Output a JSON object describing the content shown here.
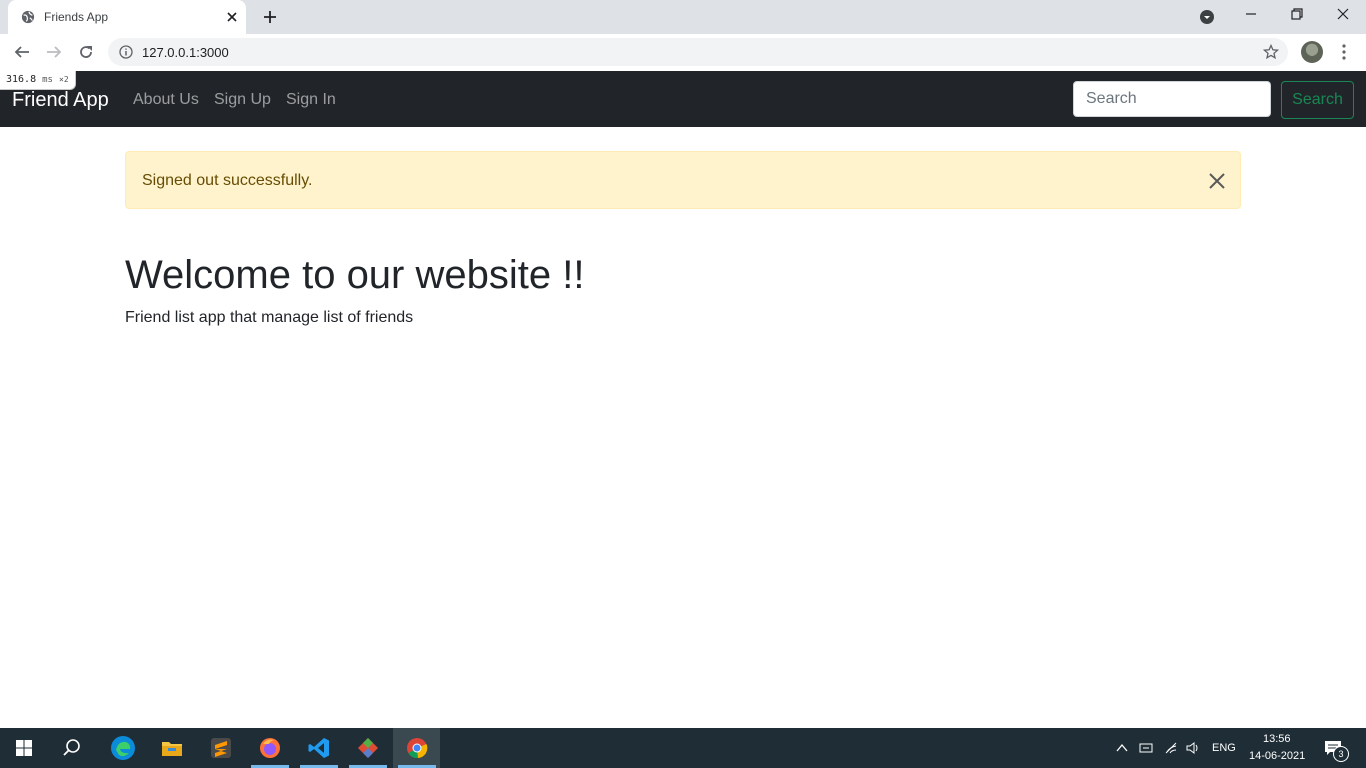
{
  "browser": {
    "tab_title": "Friends App",
    "url": "127.0.0.1:3000"
  },
  "perf_badge": {
    "value": "316.8",
    "unit": "ms",
    "multiplier": "×2"
  },
  "navbar": {
    "brand": "Friend App",
    "links": [
      "About Us",
      "Sign Up",
      "Sign In"
    ],
    "search_placeholder": "Search",
    "search_button": "Search"
  },
  "alert": {
    "message": "Signed out successfully."
  },
  "main": {
    "heading": "Welcome to our website !!",
    "lead": "Friend list app that manage list of friends"
  },
  "taskbar": {
    "language": "ENG",
    "time": "13:56",
    "date": "14-06-2021",
    "notification_count": "3"
  },
  "colors": {
    "navbar_bg": "#212529",
    "success_green": "#198754",
    "alert_bg": "#fff3cd",
    "alert_text": "#664d03"
  }
}
